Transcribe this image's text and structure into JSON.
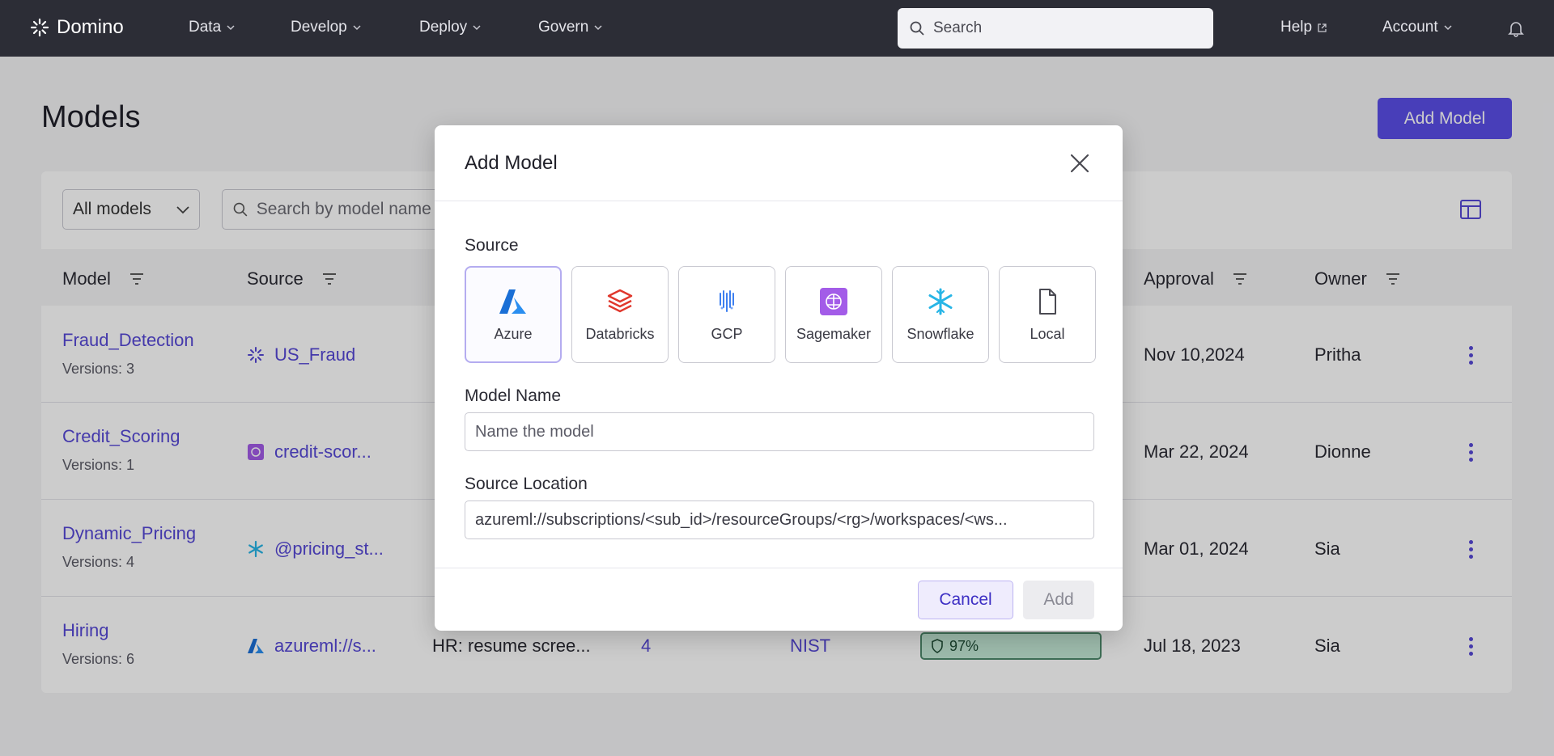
{
  "nav": {
    "brand": "Domino",
    "items": [
      "Data",
      "Develop",
      "Deploy",
      "Govern"
    ],
    "search_placeholder": "Search",
    "help": "Help",
    "account": "Account"
  },
  "page": {
    "title": "Models",
    "add_button": "Add Model",
    "filter_select": "All models",
    "search_placeholder": "Search by model name"
  },
  "table": {
    "columns": {
      "model": "Model",
      "source": "Source",
      "approval": "Approval",
      "owner": "Owner"
    },
    "rows": [
      {
        "name": "Fraud_Detection",
        "versions": "Versions: 3",
        "source": "US_Fraud",
        "source_icon": "domino-icon",
        "approval": "Nov 10,2024",
        "owner": "Pritha"
      },
      {
        "name": "Credit_Scoring",
        "versions": "Versions: 1",
        "source": "credit-scor...",
        "source_icon": "sagemaker-icon",
        "approval": "Mar 22, 2024",
        "owner": "Dionne"
      },
      {
        "name": "Dynamic_Pricing",
        "versions": "Versions: 4",
        "source": "@pricing_st...",
        "source_icon": "snowflake-icon",
        "approval": "Mar 01, 2024",
        "owner": "Sia"
      },
      {
        "name": "Hiring",
        "versions": "Versions: 6",
        "source": "azureml://s...",
        "source_icon": "azure-icon",
        "description": "HR: resume scree...",
        "count": "4",
        "framework": "NIST",
        "score": "97%",
        "approval": "Jul 18, 2023",
        "owner": "Sia"
      }
    ]
  },
  "modal": {
    "title": "Add Model",
    "source_label": "Source",
    "sources": [
      {
        "label": "Azure",
        "icon": "azure-icon",
        "selected": true
      },
      {
        "label": "Databricks",
        "icon": "databricks-icon",
        "selected": false
      },
      {
        "label": "GCP",
        "icon": "gcp-icon",
        "selected": false
      },
      {
        "label": "Sagemaker",
        "icon": "sagemaker-icon",
        "selected": false
      },
      {
        "label": "Snowflake",
        "icon": "snowflake-icon",
        "selected": false
      },
      {
        "label": "Local",
        "icon": "file-icon",
        "selected": false
      }
    ],
    "model_name_label": "Model Name",
    "model_name_placeholder": "Name the model",
    "source_location_label": "Source Location",
    "source_location_value": "azureml://subscriptions/<sub_id>/resourceGroups/<rg>/workspaces/<ws...",
    "cancel": "Cancel",
    "add": "Add"
  },
  "colors": {
    "accent": "#5b4ee8",
    "link": "#5648d6",
    "nav_bg": "#2c2d36"
  }
}
